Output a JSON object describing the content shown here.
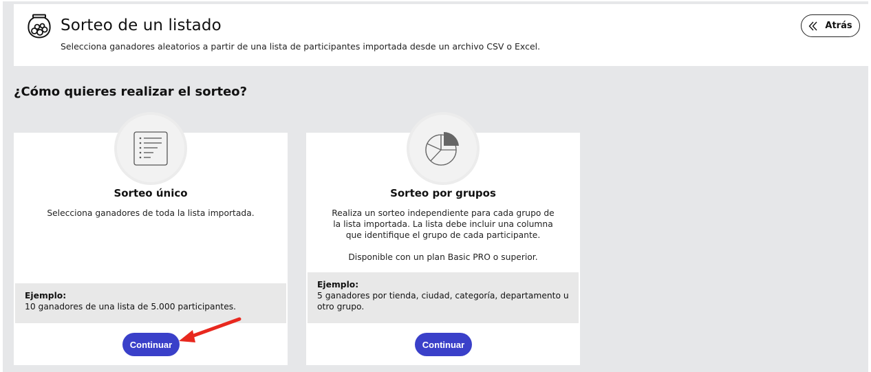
{
  "header": {
    "title": "Sorteo de un listado",
    "subtitle": "Selecciona ganadores aleatorios a partir de una lista de participantes importada desde un archivo CSV o Excel.",
    "back_label": "Atrás",
    "icon": "fishbowl-icon"
  },
  "question": "¿Cómo quieres realizar el sorteo?",
  "cards": [
    {
      "icon": "list-icon",
      "title": "Sorteo único",
      "description": "Selecciona ganadores de toda la lista importada.",
      "example_label": "Ejemplo:",
      "example_text": "10 ganadores de una lista de 5.000 participantes.",
      "button_label": "Continuar"
    },
    {
      "icon": "pie-chart-icon",
      "title": "Sorteo por grupos",
      "description": "Realiza un sorteo independiente para cada grupo de la lista importada. La lista debe incluir una columna que identifique el grupo de cada participante.",
      "availability": "Disponible con un plan Basic PRO o superior.",
      "example_label": "Ejemplo:",
      "example_text": "5 ganadores por tienda, ciudad, categoría, departamento u otro grupo.",
      "button_label": "Continuar"
    }
  ],
  "colors": {
    "accent": "#3a40c9",
    "annotation_arrow": "#e8281e",
    "background": "#e6e7e9"
  }
}
